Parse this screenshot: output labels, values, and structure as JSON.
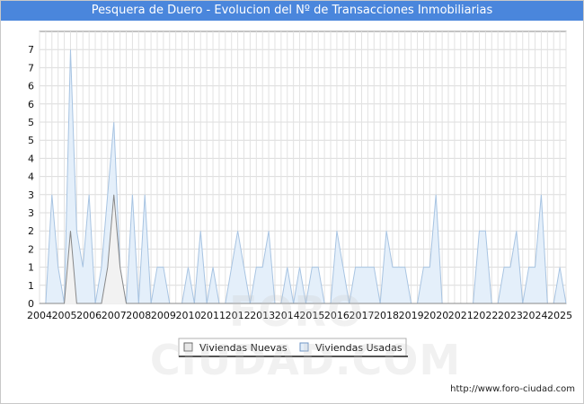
{
  "title": "Pesquera de Duero - Evolucion del Nº de Transacciones Inmobiliarias",
  "footer_url": "http://www.foro-ciudad.com",
  "watermark": "FORO-CIUDAD.COM",
  "chart_data": {
    "type": "area",
    "x_ticks": [
      "2004",
      "2005",
      "2006",
      "2007",
      "2008",
      "2009",
      "2010",
      "2011",
      "2012",
      "2013",
      "2014",
      "2015",
      "2016",
      "2017",
      "2018",
      "2019",
      "2020",
      "2021",
      "2022",
      "2023",
      "2024",
      "2025"
    ],
    "y_ticks": [
      "0",
      "1",
      "1",
      "2",
      "2",
      "3",
      "3",
      "4",
      "4",
      "5",
      "5",
      "6",
      "6",
      "7",
      "7"
    ],
    "ylim": [
      0,
      7.5
    ],
    "xlim": [
      2004,
      2025.25
    ],
    "legend_position": "bottom",
    "grid": true,
    "series": [
      {
        "name": "Viviendas Nuevas",
        "color": "#888888",
        "fill": "#f2f2f2",
        "points": [
          [
            2004,
            0
          ],
          [
            2005,
            0
          ],
          [
            2005.25,
            2
          ],
          [
            2005.5,
            0
          ],
          [
            2006,
            0
          ],
          [
            2006.5,
            0
          ],
          [
            2006.75,
            1
          ],
          [
            2007,
            3
          ],
          [
            2007.25,
            1
          ],
          [
            2007.5,
            0
          ],
          [
            2025.25,
            0
          ]
        ]
      },
      {
        "name": "Viviendas Usadas",
        "color": "#a8c4e2",
        "fill": "#e4effa",
        "points": [
          [
            2004,
            0
          ],
          [
            2004.25,
            0
          ],
          [
            2004.5,
            3
          ],
          [
            2004.75,
            1
          ],
          [
            2005,
            0
          ],
          [
            2005.25,
            7
          ],
          [
            2005.5,
            2
          ],
          [
            2005.75,
            1
          ],
          [
            2006,
            3
          ],
          [
            2006.25,
            0
          ],
          [
            2006.5,
            1
          ],
          [
            2006.75,
            3
          ],
          [
            2007,
            5
          ],
          [
            2007.25,
            1
          ],
          [
            2007.5,
            0
          ],
          [
            2007.75,
            3
          ],
          [
            2008,
            0
          ],
          [
            2008.25,
            3
          ],
          [
            2008.5,
            0
          ],
          [
            2008.75,
            1
          ],
          [
            2009,
            1
          ],
          [
            2009.25,
            0
          ],
          [
            2009.5,
            0
          ],
          [
            2009.75,
            0
          ],
          [
            2010,
            1
          ],
          [
            2010.25,
            0
          ],
          [
            2010.5,
            2
          ],
          [
            2010.75,
            0
          ],
          [
            2011,
            1
          ],
          [
            2011.25,
            0
          ],
          [
            2011.5,
            0
          ],
          [
            2011.75,
            1
          ],
          [
            2012,
            2
          ],
          [
            2012.25,
            1
          ],
          [
            2012.5,
            0
          ],
          [
            2012.75,
            1
          ],
          [
            2013,
            1
          ],
          [
            2013.25,
            2
          ],
          [
            2013.5,
            0
          ],
          [
            2013.75,
            0
          ],
          [
            2014,
            1
          ],
          [
            2014.25,
            0
          ],
          [
            2014.5,
            1
          ],
          [
            2014.75,
            0
          ],
          [
            2015,
            1
          ],
          [
            2015.25,
            1
          ],
          [
            2015.5,
            0
          ],
          [
            2015.75,
            0
          ],
          [
            2016,
            2
          ],
          [
            2016.25,
            1
          ],
          [
            2016.5,
            0
          ],
          [
            2016.75,
            1
          ],
          [
            2017,
            1
          ],
          [
            2017.25,
            1
          ],
          [
            2017.5,
            1
          ],
          [
            2017.75,
            0
          ],
          [
            2018,
            2
          ],
          [
            2018.25,
            1
          ],
          [
            2018.5,
            1
          ],
          [
            2018.75,
            1
          ],
          [
            2019,
            0
          ],
          [
            2019.25,
            0
          ],
          [
            2019.5,
            1
          ],
          [
            2019.75,
            1
          ],
          [
            2020,
            3
          ],
          [
            2020.25,
            0
          ],
          [
            2020.5,
            0
          ],
          [
            2020.75,
            0
          ],
          [
            2021,
            0
          ],
          [
            2021.25,
            0
          ],
          [
            2021.5,
            0
          ],
          [
            2021.75,
            2
          ],
          [
            2022,
            2
          ],
          [
            2022.25,
            0
          ],
          [
            2022.5,
            0
          ],
          [
            2022.75,
            1
          ],
          [
            2023,
            1
          ],
          [
            2023.25,
            2
          ],
          [
            2023.5,
            0
          ],
          [
            2023.75,
            1
          ],
          [
            2024,
            1
          ],
          [
            2024.25,
            3
          ],
          [
            2024.5,
            0
          ],
          [
            2024.75,
            0
          ],
          [
            2025,
            1
          ],
          [
            2025.25,
            0
          ]
        ]
      }
    ]
  }
}
